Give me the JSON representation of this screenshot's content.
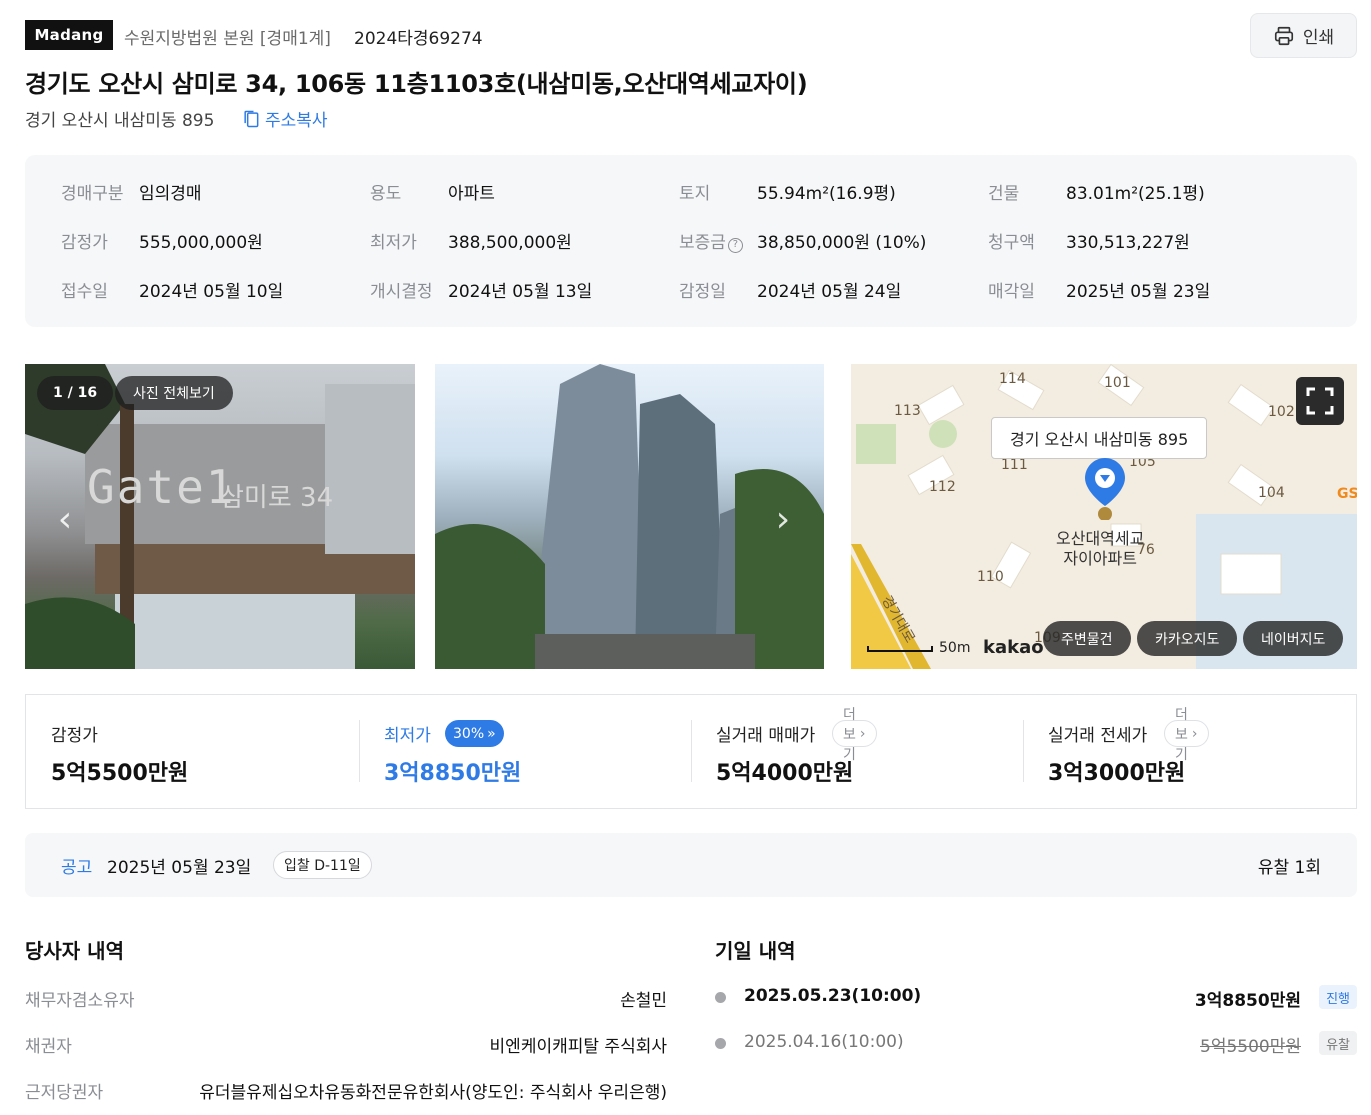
{
  "header": {
    "logo": "Madang",
    "court": "수원지방법원 본원 [경매1계]",
    "case_no": "2024타경69274",
    "print_label": "인쇄"
  },
  "title": "경기도 오산시 삼미로 34, 106동 11층1103호(내삼미동,오산대역세교자이)",
  "address": {
    "jibun": "경기 오산시 내삼미동 895",
    "copy_label": "주소복사"
  },
  "info": [
    {
      "label": "경매구분",
      "value": "임의경매"
    },
    {
      "label": "용도",
      "value": "아파트"
    },
    {
      "label": "토지",
      "value": "55.94m²(16.9평)"
    },
    {
      "label": "건물",
      "value": "83.01m²(25.1평)"
    },
    {
      "label": "감정가",
      "value": "555,000,000원"
    },
    {
      "label": "최저가",
      "value": "388,500,000원"
    },
    {
      "label": "보증금",
      "value": "38,850,000원 (10%)"
    },
    {
      "label": "청구액",
      "value": "330,513,227원"
    },
    {
      "label": "접수일",
      "value": "2024년 05월 10일"
    },
    {
      "label": "개시결정",
      "value": "2024년 05월 13일"
    },
    {
      "label": "감정일",
      "value": "2024년 05월 24일"
    },
    {
      "label": "매각일",
      "value": "2025년 05월 23일"
    }
  ],
  "photos": {
    "counter": "1 / 16",
    "view_all": "사진 전체보기",
    "sign_text": "Gate1",
    "sign_sub": "삼미로 34"
  },
  "map": {
    "tooltip": "경기 오산시 내삼미동 895",
    "place_name_1": "오산대역세교",
    "place_name_2": "자이아파트",
    "building_labels": [
      "114",
      "101",
      "113",
      "102",
      "111",
      "105",
      "112",
      "104",
      "110",
      "109",
      "76"
    ],
    "road_label": "경기대로",
    "gs_label": "GS",
    "scale_label": "50m",
    "provider": "kakao",
    "buttons": [
      "주변물건",
      "카카오지도",
      "네이버지도"
    ]
  },
  "prices": {
    "appraisal": {
      "label": "감정가",
      "value": "5억5500만원"
    },
    "minimum": {
      "label": "최저가",
      "value": "3억8850만원",
      "percent": "30%"
    },
    "trade": {
      "label": "실거래 매매가",
      "value": "5억4000만원",
      "more": "더보기"
    },
    "jeonse": {
      "label": "실거래 전세가",
      "value": "3억3000만원",
      "more": "더보기"
    }
  },
  "notice": {
    "label": "공고",
    "date": "2025년 05월 23일",
    "dday": "입찰 D-11일",
    "fail_count": "유찰 1회"
  },
  "parties": {
    "title": "당사자 내역",
    "rows": [
      {
        "key": "채무자겸소유자",
        "value": "손철민"
      },
      {
        "key": "채권자",
        "value": "비엔케이캐피탈 주식회사"
      },
      {
        "key": "근저당권자",
        "value": "유더블유제십오차유동화전문유한회사(양도인: 주식회사 우리은행)"
      }
    ]
  },
  "dates": {
    "title": "기일 내역",
    "rows": [
      {
        "date": "2025.05.23(10:00)",
        "amount": "3억8850만원",
        "status": "진행"
      },
      {
        "date": "2025.04.16(10:00)",
        "amount": "5억5500만원",
        "status": "유찰"
      }
    ]
  },
  "colors": {
    "accent": "#2f7be5",
    "muted": "#8a8d93",
    "panel": "#f6f7f9"
  }
}
